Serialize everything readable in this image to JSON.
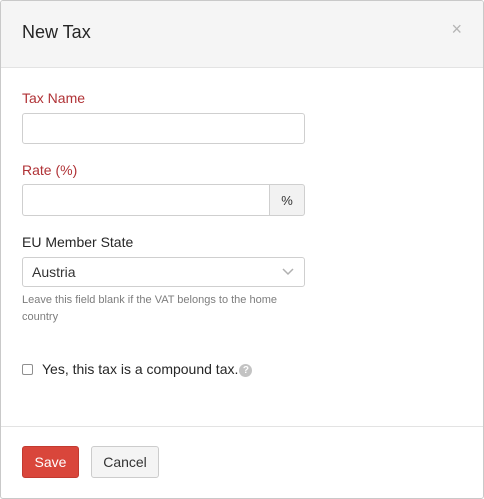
{
  "dialog": {
    "title": "New Tax",
    "close_symbol": "×"
  },
  "form": {
    "tax_name": {
      "label": "Tax Name",
      "value": "",
      "placeholder": ""
    },
    "rate": {
      "label": "Rate (%)",
      "value": "",
      "addon": "%"
    },
    "eu_member_state": {
      "label": "EU Member State",
      "selected": "Austria",
      "help": "Leave this field blank if the VAT belongs to the home country"
    },
    "compound": {
      "label": "Yes, this tax is a compound tax.",
      "checked": false,
      "help_icon": "question-icon"
    }
  },
  "footer": {
    "save_label": "Save",
    "cancel_label": "Cancel"
  },
  "colors": {
    "required_label": "#b03236",
    "save_button": "#d9463b"
  }
}
